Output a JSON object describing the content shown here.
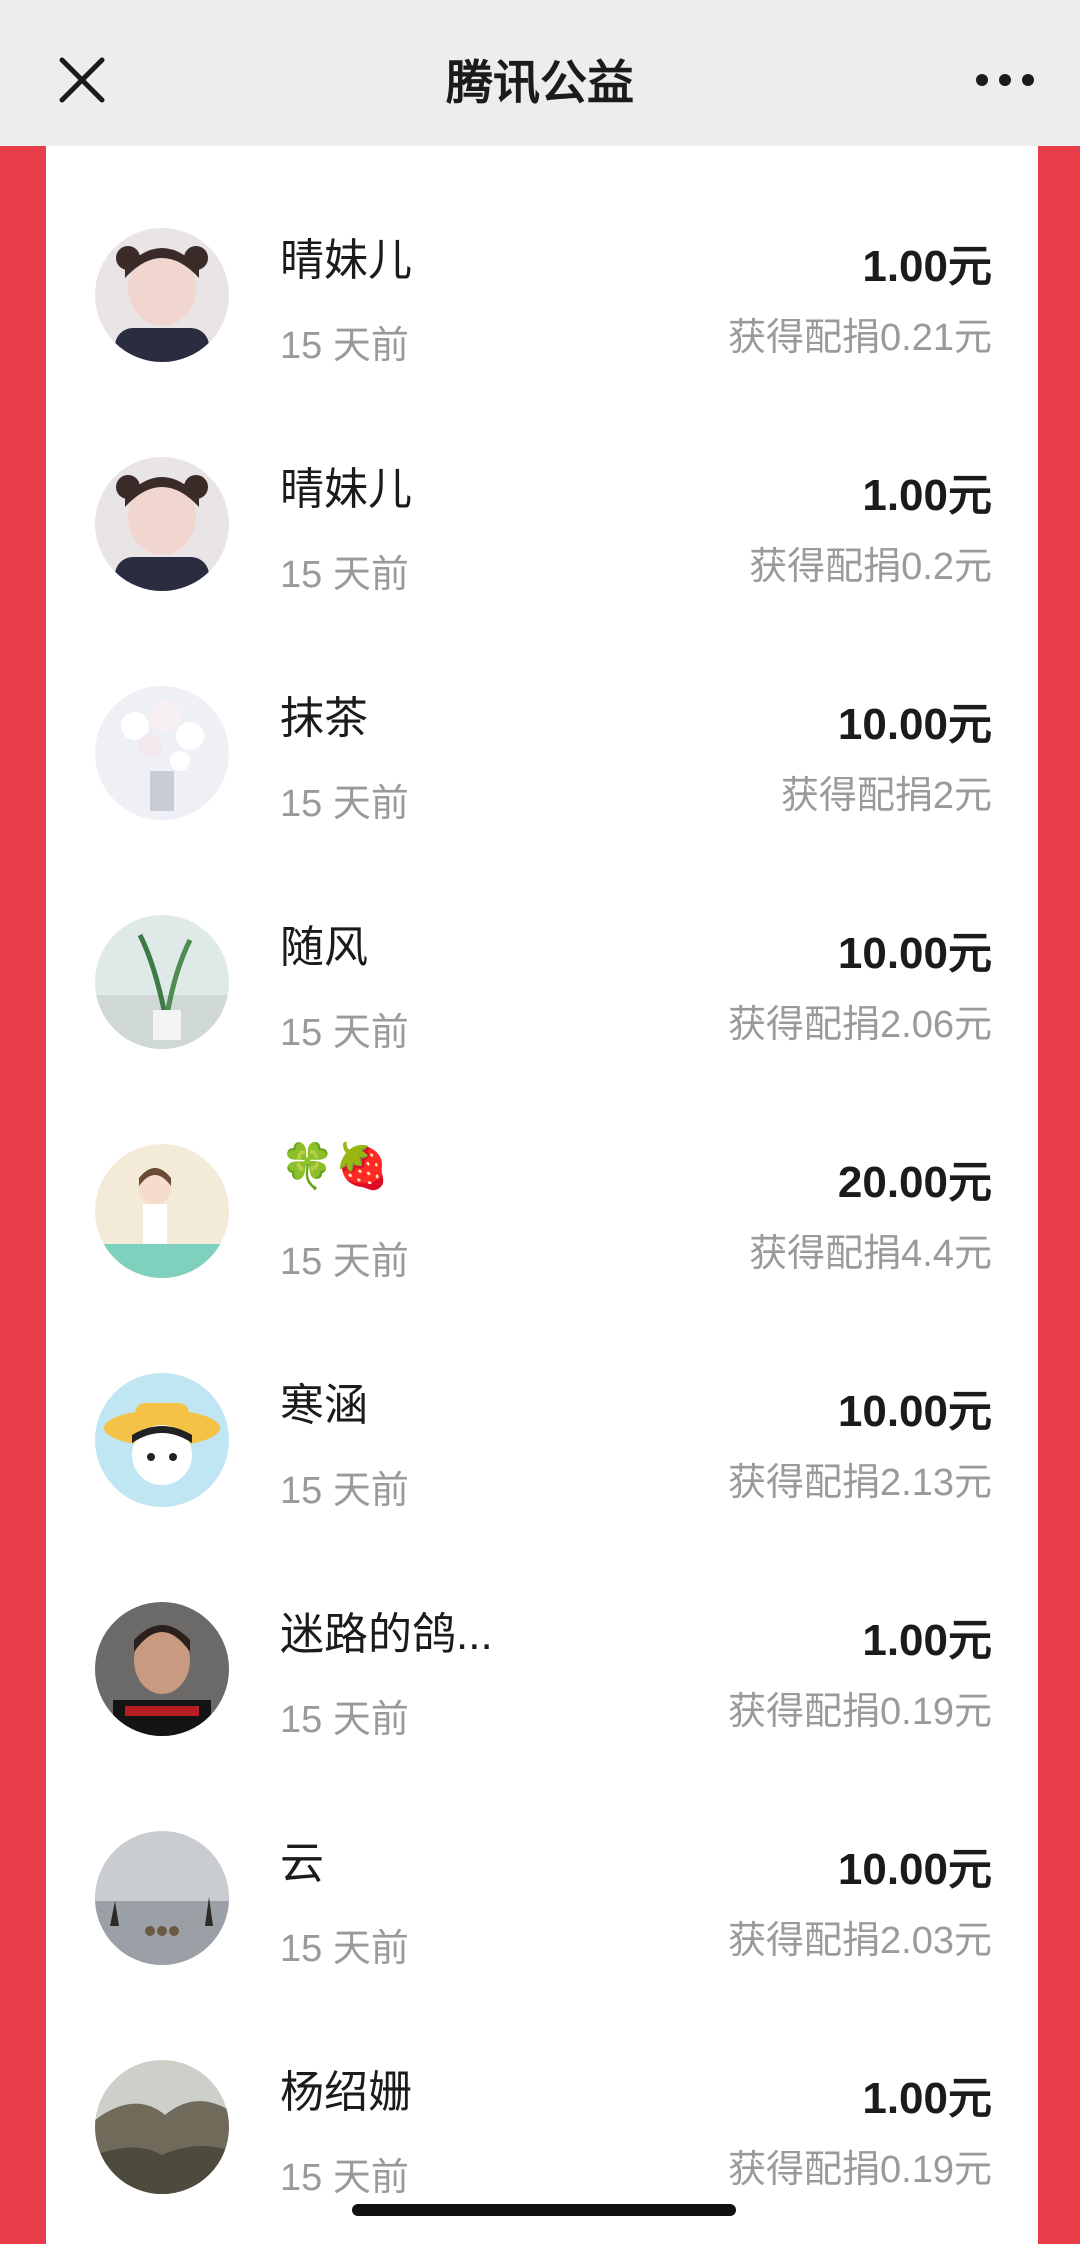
{
  "header": {
    "title": "腾讯公益",
    "close_icon": "close-icon",
    "more_icon": "more-icon"
  },
  "donations": [
    {
      "name": "晴妹儿",
      "time": "15 天前",
      "amount": "1.00元",
      "match": "获得配捐0.21元",
      "avatar": "girl-photo"
    },
    {
      "name": "晴妹儿",
      "time": "15 天前",
      "amount": "1.00元",
      "match": "获得配捐0.2元",
      "avatar": "girl-photo"
    },
    {
      "name": "抹茶",
      "time": "15 天前",
      "amount": "10.00元",
      "match": "获得配捐2元",
      "avatar": "flowers"
    },
    {
      "name": "随风",
      "time": "15 天前",
      "amount": "10.00元",
      "match": "获得配捐2.06元",
      "avatar": "plant-room"
    },
    {
      "name": "🍀🍓",
      "time": "15 天前",
      "amount": "20.00元",
      "match": "获得配捐4.4元",
      "avatar": "cartoon-girl"
    },
    {
      "name": "寒涵",
      "time": "15 天前",
      "amount": "10.00元",
      "match": "获得配捐2.13元",
      "avatar": "straw-hat-girl"
    },
    {
      "name": "迷路的鸽...",
      "time": "15 天前",
      "amount": "1.00元",
      "match": "获得配捐0.19元",
      "avatar": "man-portrait"
    },
    {
      "name": "云",
      "time": "15 天前",
      "amount": "10.00元",
      "match": "获得配捐2.03元",
      "avatar": "geese-lake"
    },
    {
      "name": "杨绍姗",
      "time": "15 天前",
      "amount": "1.00元",
      "match": "获得配捐0.19元",
      "avatar": "rocky-landscape"
    }
  ],
  "colors": {
    "accent_red": "#e73d49",
    "header_bg": "#ededed",
    "text_primary": "#1b1b1b",
    "text_secondary": "#9a9a9a"
  }
}
